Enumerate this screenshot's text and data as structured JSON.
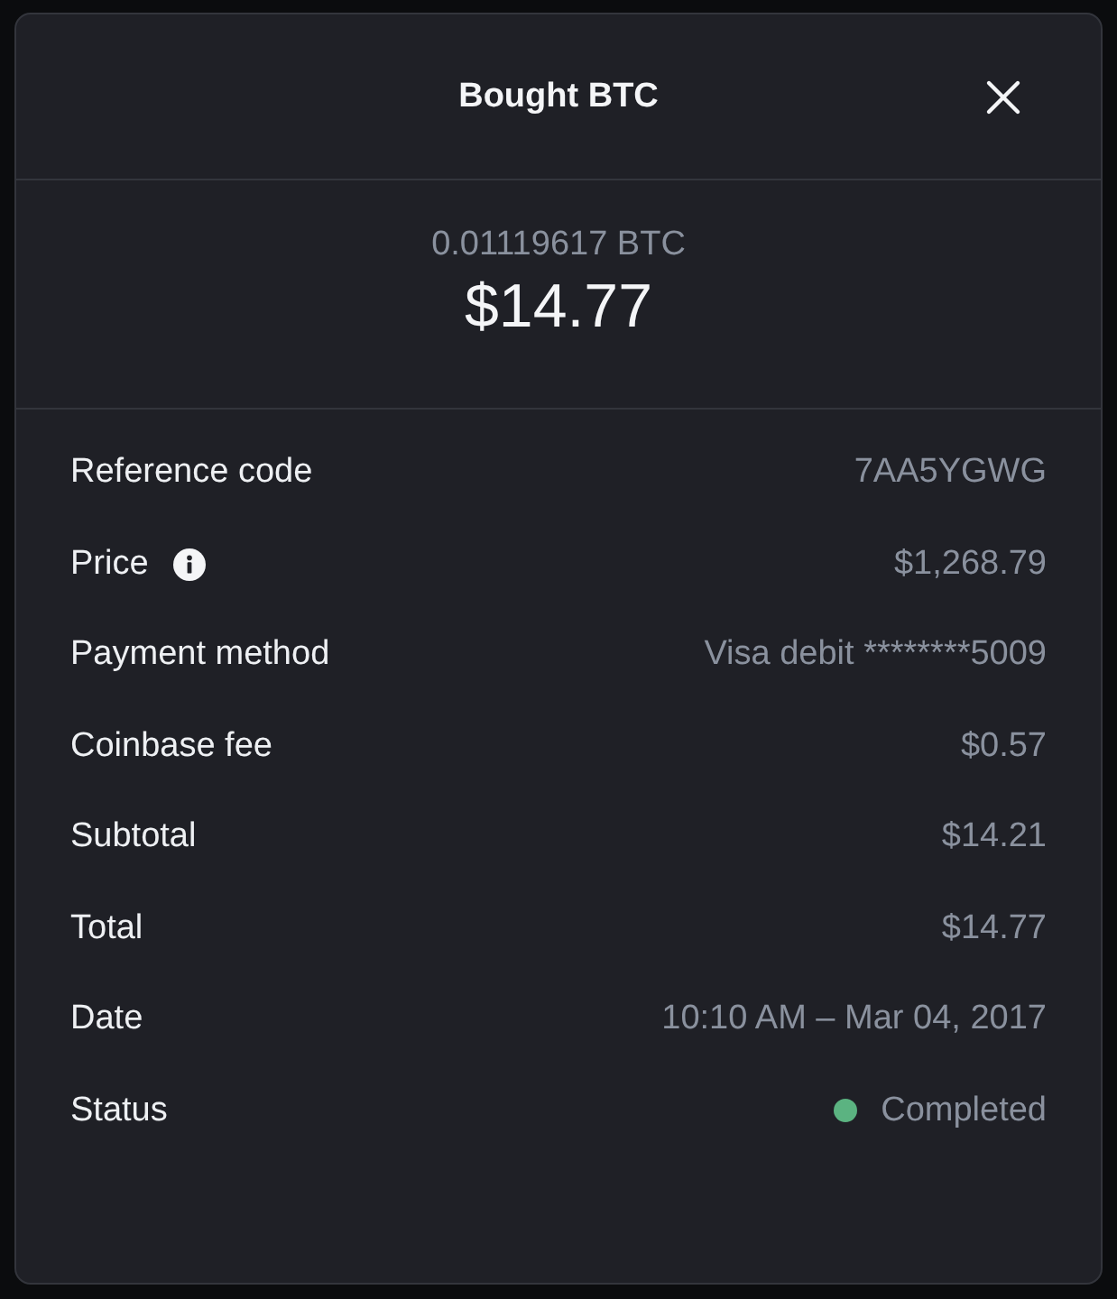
{
  "dialog": {
    "title": "Bought BTC"
  },
  "summary": {
    "crypto_amount": "0.01119617 BTC",
    "fiat_amount": "$14.77"
  },
  "details": [
    {
      "kind": "text",
      "label": "Reference code",
      "value": "7AA5YGWG"
    },
    {
      "kind": "info",
      "label": "Price",
      "value": "$1,268.79"
    },
    {
      "kind": "text",
      "label": "Payment method",
      "value": "Visa debit ********5009"
    },
    {
      "kind": "text",
      "label": "Coinbase fee",
      "value": "$0.57"
    },
    {
      "kind": "text",
      "label": "Subtotal",
      "value": "$14.21"
    },
    {
      "kind": "text",
      "label": "Total",
      "value": "$14.77"
    },
    {
      "kind": "text",
      "label": "Date",
      "value": "10:10 AM – Mar 04, 2017"
    },
    {
      "kind": "status",
      "label": "Status",
      "value": "Completed",
      "color": "#5bb381"
    }
  ]
}
